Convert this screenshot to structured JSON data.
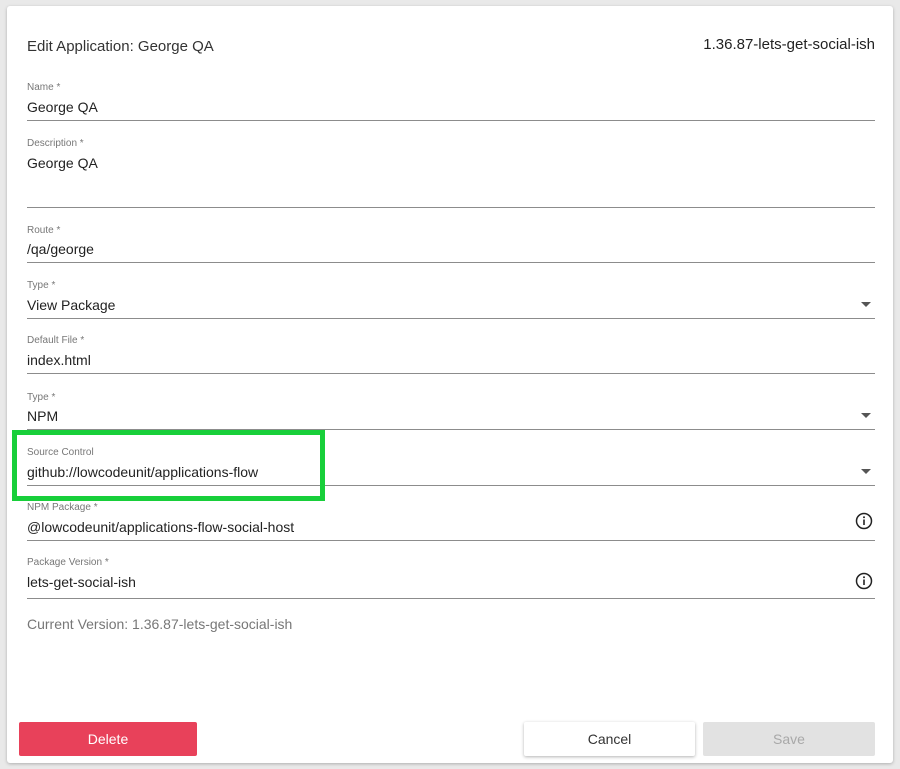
{
  "header": {
    "title": "Edit Application: George QA",
    "version": "1.36.87-lets-get-social-ish"
  },
  "fields": {
    "name": {
      "label": "Name *",
      "value": "George QA"
    },
    "description": {
      "label": "Description *",
      "value": "George QA"
    },
    "route": {
      "label": "Route *",
      "value": "/qa/george"
    },
    "type": {
      "label": "Type *",
      "value": "View Package"
    },
    "default_file": {
      "label": "Default File *",
      "value": "index.html"
    },
    "package_type": {
      "label": "Type *",
      "value": "NPM"
    },
    "source_control": {
      "label": "Source Control",
      "value": "github://lowcodeunit/applications-flow"
    },
    "npm_package": {
      "label": "NPM Package *",
      "value": "@lowcodeunit/applications-flow-social-host"
    },
    "package_version": {
      "label": "Package Version *",
      "value": "lets-get-social-ish"
    }
  },
  "current_version": "Current Version: 1.36.87-lets-get-social-ish",
  "buttons": {
    "delete": "Delete",
    "cancel": "Cancel",
    "save": "Save"
  },
  "icons": {
    "dropdown": "chevron-down-icon",
    "info": "info-icon"
  },
  "colors": {
    "delete": "#e8415a",
    "highlight": "#18cf3a",
    "save_disabled": "#e2e2e2"
  }
}
